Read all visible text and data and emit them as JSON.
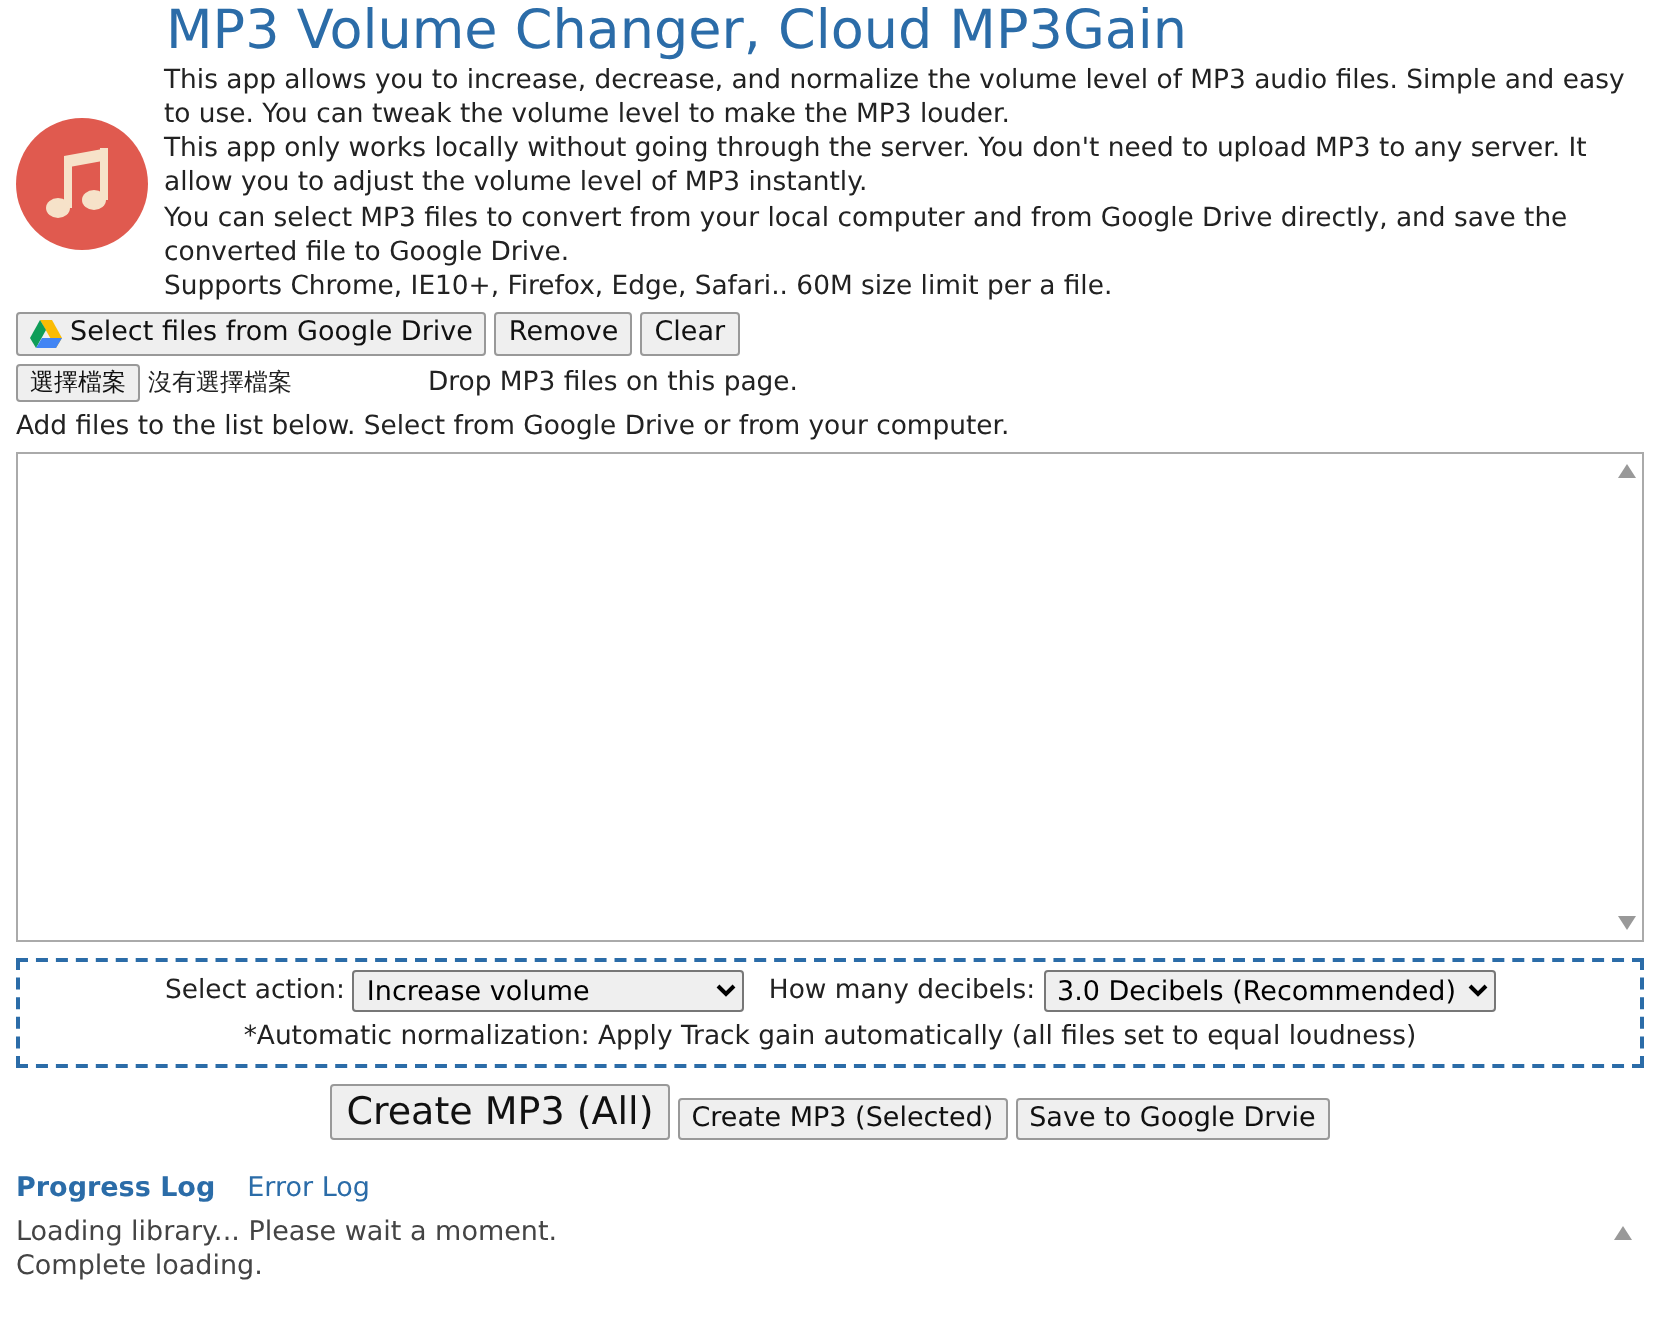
{
  "header": {
    "title": "MP3 Volume Changer, Cloud MP3Gain",
    "description": [
      "This app allows you to increase, decrease, and normalize the volume level of MP3 audio files. Simple and easy to use. You can tweak the volume level to make the MP3 louder.",
      "This app only works locally without going through the server. You don't need to upload MP3 to any server. It allow you to adjust the volume level of MP3 instantly.",
      "You can select MP3 files to convert from your local computer and from Google Drive directly, and save the converted file to Google Drive.",
      "Supports Chrome, IE10+, Firefox, Edge, Safari.. 60M size limit per a file."
    ]
  },
  "toolbar": [
    {
      "label": "Select files from Google Drive",
      "kind": "drive"
    },
    {
      "label": "Remove",
      "kind": "plain"
    },
    {
      "label": "Clear",
      "kind": "plain"
    }
  ],
  "file_input": {
    "button": "選擇檔案",
    "status": "沒有選擇檔案",
    "drop_hint": "Drop MP3 files on this page."
  },
  "list_hint": "Add files to the list below. Select from Google Drive or from your computer.",
  "options": {
    "action_label": "Select action:",
    "action_value": "Increase volume",
    "decibels_label": "How many decibels:",
    "decibels_value": "3.0 Decibels (Recommended)",
    "note": "*Automatic normalization: Apply Track gain automatically (all files set to equal loudness)"
  },
  "actions": [
    {
      "label": "Create MP3 (All)",
      "kind": "large"
    },
    {
      "label": "Create MP3 (Selected)",
      "kind": "normal"
    },
    {
      "label": "Save to Google Drvie",
      "kind": "normal"
    }
  ],
  "log_tabs": [
    {
      "label": "Progress Log",
      "selected": true
    },
    {
      "label": "Error Log",
      "selected": false
    }
  ],
  "log_lines": [
    "Loading library... Please wait a moment.",
    "Complete loading."
  ]
}
